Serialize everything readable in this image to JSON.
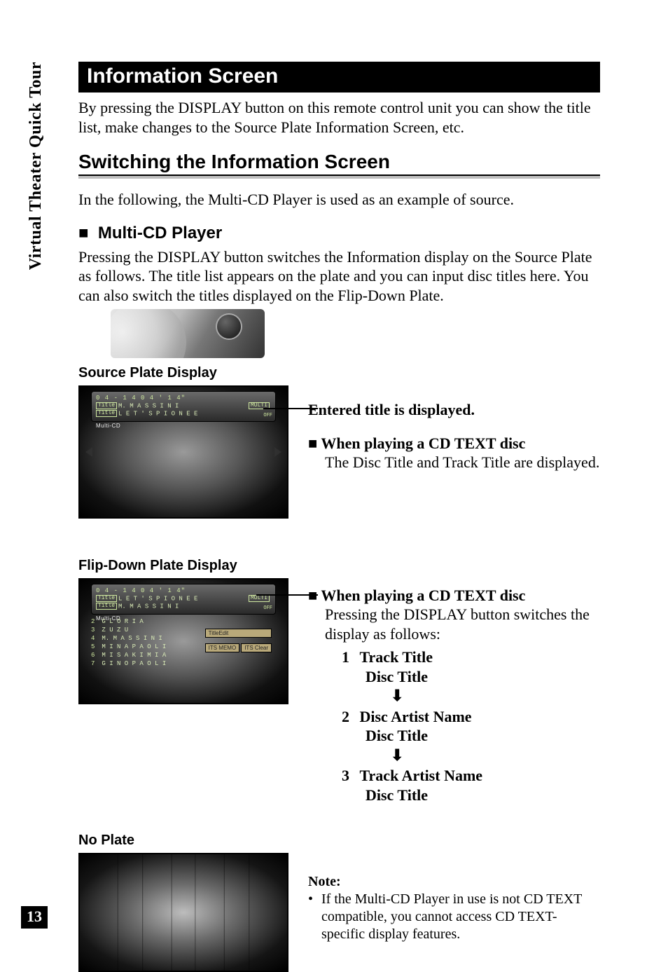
{
  "side_label": "Virtual Theater Quick Tour",
  "page_number": "13",
  "section_title": "Information Screen",
  "intro": "By pressing the DISPLAY button on this remote control unit you can show the title list, make changes to the Source Plate Information Screen, etc.",
  "h2": "Switching the Information Screen",
  "h2_intro": "In the following, the Multi-CD Player is used as an example of source.",
  "h3": "Multi-CD Player",
  "h3_body": "Pressing the DISPLAY button switches the Information display on the Source Plate as follows. The title list appears on the plate and you can input disc titles here. You can also switch the titles displayed on the Flip-Down Plate.",
  "captions": {
    "source_plate": "Source Plate Display",
    "flip_down": "Flip-Down Plate Display",
    "no_plate": "No Plate"
  },
  "source_plate_screen": {
    "multi_cd_label": "Multi-CD",
    "time_line": "0 4 - 1 4  0 4 ' 1 4\"",
    "title_line": "M. M A S S I N I",
    "subtitle_line": "L E T ' S   P I O N E E",
    "mode_badge": "MULTI",
    "off_badge": "OFF",
    "callout": "Entered title is displayed.",
    "cd_text": {
      "header": "When playing a CD TEXT disc",
      "body": "The Disc Title and Track Title are displayed."
    }
  },
  "flip_down_screen": {
    "multi_cd_label": "Multi-CD",
    "time_line": "0 4 - 1 4  0 4 ' 1 4\"",
    "title_line": "L E T ' S   P I O N E E",
    "subtitle_line": "M. M A S S I N I",
    "off_badge": "OFF",
    "list": [
      {
        "n": "2",
        "t": "G L O R I A"
      },
      {
        "n": "3",
        "t": "Z U Z U"
      },
      {
        "n": "4",
        "t": "M. M A S S I N I"
      },
      {
        "n": "5",
        "t": "M I N A   P A O L I"
      },
      {
        "n": "6",
        "t": "M I S A K I   M I A"
      },
      {
        "n": "7",
        "t": "G I N O   P A O L I"
      }
    ],
    "buttons": {
      "title_edit": "TitleEdit",
      "its_memo": "ITS MEMO",
      "its_clear": "ITS Clear"
    },
    "cd_text": {
      "header": "When playing a CD TEXT disc",
      "body": "Pressing the DISPLAY button switches the display as follows:"
    },
    "sequence": [
      {
        "n": "1",
        "a": "Track Title",
        "b": "Disc Title"
      },
      {
        "n": "2",
        "a": "Disc Artist Name",
        "b": "Disc Title"
      },
      {
        "n": "3",
        "a": "Track Artist Name",
        "b": "Disc Title"
      }
    ],
    "arrow_glyph": "⬇"
  },
  "note": {
    "header": "Note:",
    "body": "If the Multi-CD Player in use is not CD TEXT compatible, you cannot access CD TEXT-specific display features."
  }
}
